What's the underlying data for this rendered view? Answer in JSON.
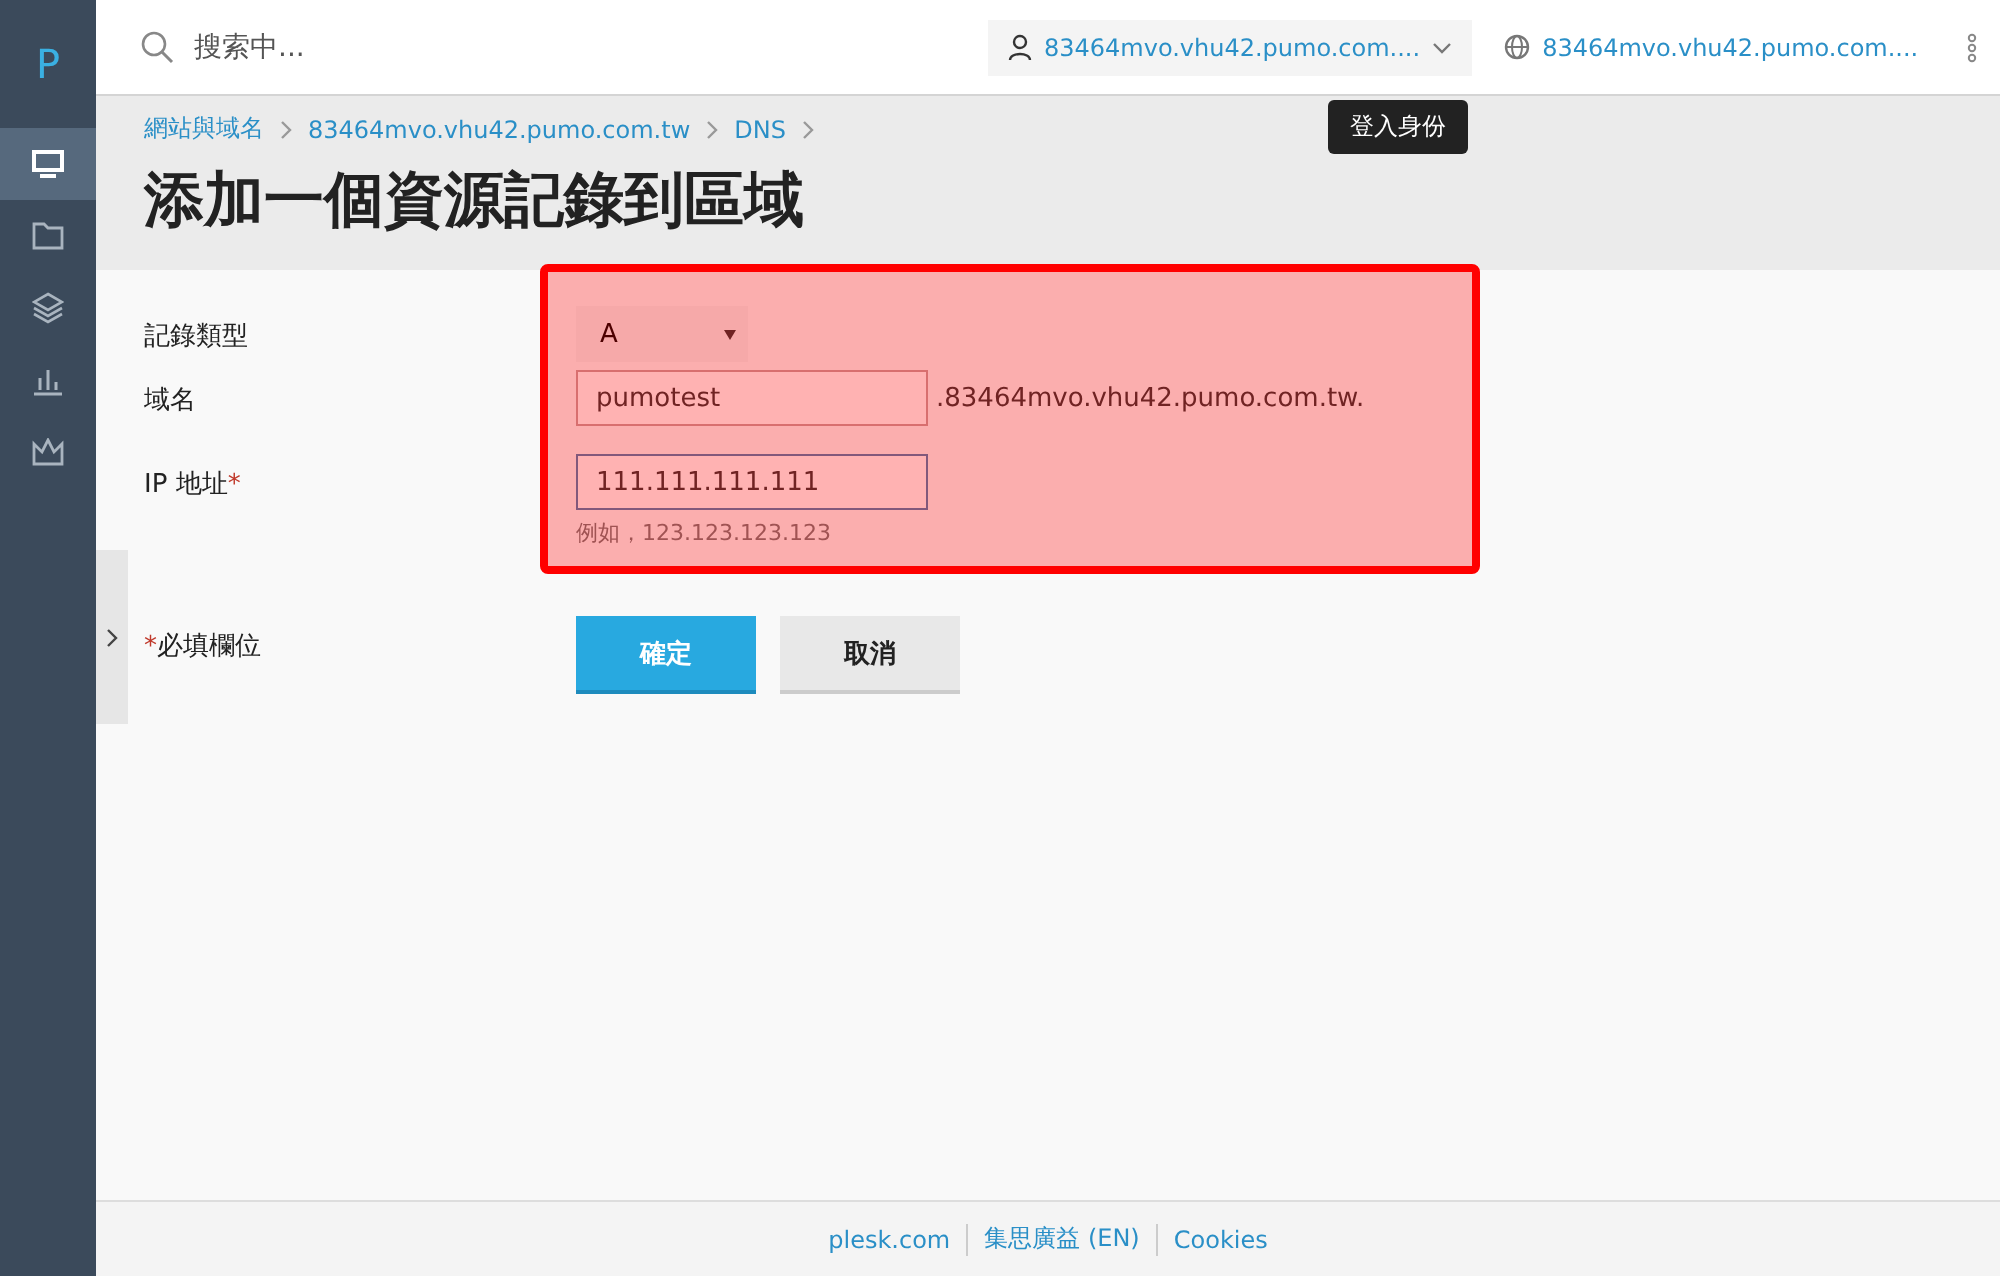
{
  "sidebar": {
    "logo": "P",
    "items": [
      {
        "kind": "monitor",
        "selected": true
      },
      {
        "kind": "folder",
        "selected": false
      },
      {
        "kind": "layers",
        "selected": false
      },
      {
        "kind": "chart",
        "selected": false
      },
      {
        "kind": "crown",
        "selected": false
      }
    ]
  },
  "topbar": {
    "search": {
      "placeholder": "搜索中..."
    },
    "user": "83464mvo.vhu42.pumo.com....",
    "site": "83464mvo.vhu42.pumo.com....",
    "tooltip": "登入身份"
  },
  "breadcrumbs": [
    "網站與域名",
    "83464mvo.vhu42.pumo.com.tw",
    "DNS"
  ],
  "title": "添加一個資源記錄到區域",
  "form": {
    "fields": [
      {
        "kind": "select",
        "label": "記錄類型",
        "value": "A"
      },
      {
        "kind": "text",
        "label": "域名",
        "value": "pumotest",
        "focused": false,
        "suffix": ".83464mvo.vhu42.pumo.com.tw."
      },
      {
        "kind": "text",
        "label": "IP 地址",
        "required_mark": "*",
        "value": "111.111.111.111",
        "focused": true,
        "hint": "例如，123.123.123.123"
      }
    ],
    "required_mark": "*",
    "required_note": "必填欄位",
    "buttons": [
      {
        "label": "確定",
        "primary": true
      },
      {
        "label": "取消",
        "primary": false
      }
    ]
  },
  "footer": [
    "plesk.com",
    "集思廣益 (EN)",
    "Cookies"
  ]
}
